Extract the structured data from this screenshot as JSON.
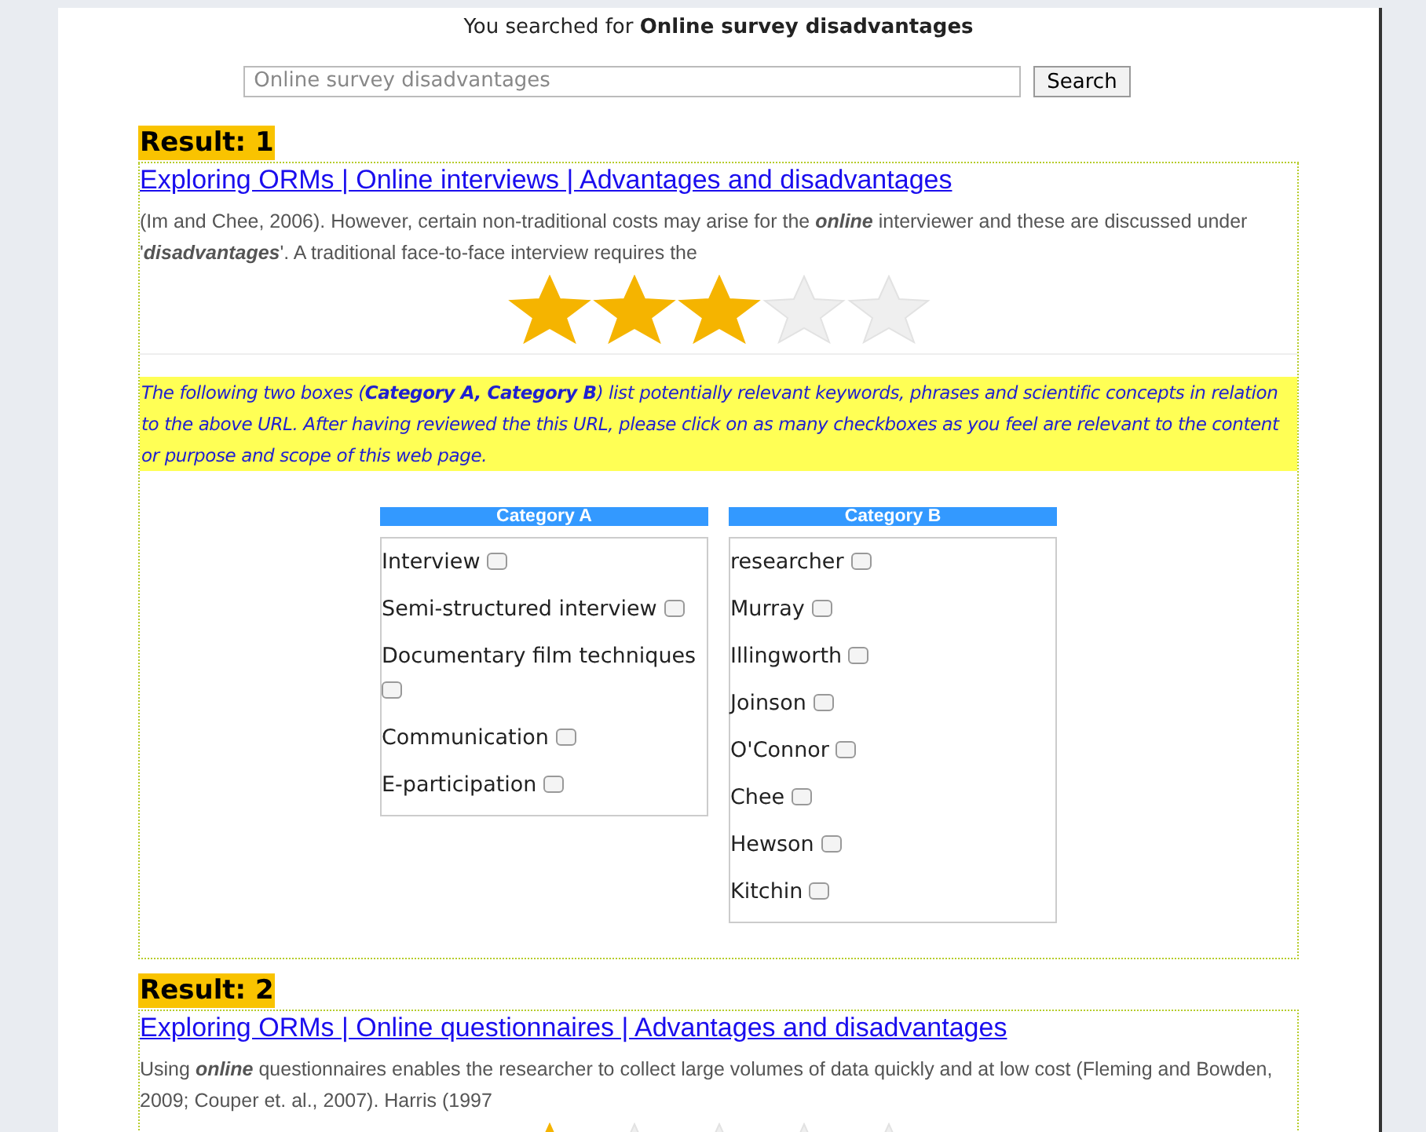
{
  "search_summary": {
    "prefix": "You searched for",
    "query": "Online survey disadvantages"
  },
  "search": {
    "value": "Online survey disadvantages",
    "button": "Search"
  },
  "results": [
    {
      "label": "Result: 1",
      "title": "Exploring ORMs | Online interviews | Advantages and disadvantages",
      "snippet": "(Im and Chee, 2006). However, certain non-traditional costs may arise for the **online** interviewer and these are discussed under '**disadvantages**'. A traditional face-to-face interview requires the",
      "stars": 3,
      "instructions": "The following two boxes (**Category A, Category B**) list potentially relevant keywords, phrases and scientific concepts in relation to the above URL. After having reviewed the this URL, please click on as many checkboxes as you feel are relevant to the content or purpose and scope of this web page.",
      "categories": [
        {
          "title": "Category A",
          "items": [
            {
              "label": "Interview",
              "checked": false
            },
            {
              "label": "Semi-structured interview",
              "checked": false
            },
            {
              "label": "Documentary film techniques",
              "checked": false
            },
            {
              "label": "Communication",
              "checked": false
            },
            {
              "label": "E-participation",
              "checked": false
            }
          ]
        },
        {
          "title": "Category B",
          "items": [
            {
              "label": "researcher",
              "checked": false
            },
            {
              "label": "Murray",
              "checked": false
            },
            {
              "label": "Illingworth",
              "checked": false
            },
            {
              "label": "Joinson",
              "checked": false
            },
            {
              "label": "O'Connor",
              "checked": false
            },
            {
              "label": "Chee",
              "checked": false
            },
            {
              "label": "Hewson",
              "checked": false
            },
            {
              "label": "Kitchin",
              "checked": false
            }
          ]
        }
      ]
    },
    {
      "label": "Result: 2",
      "title": "Exploring ORMs | Online questionnaires | Advantages and disadvantages",
      "snippet": "Using **online** questionnaires enables the researcher to collect large volumes of data quickly and at low cost (Fleming and Bowden, 2009; Couper et. al., 2007). Harris (1997",
      "stars": 1
    }
  ]
}
